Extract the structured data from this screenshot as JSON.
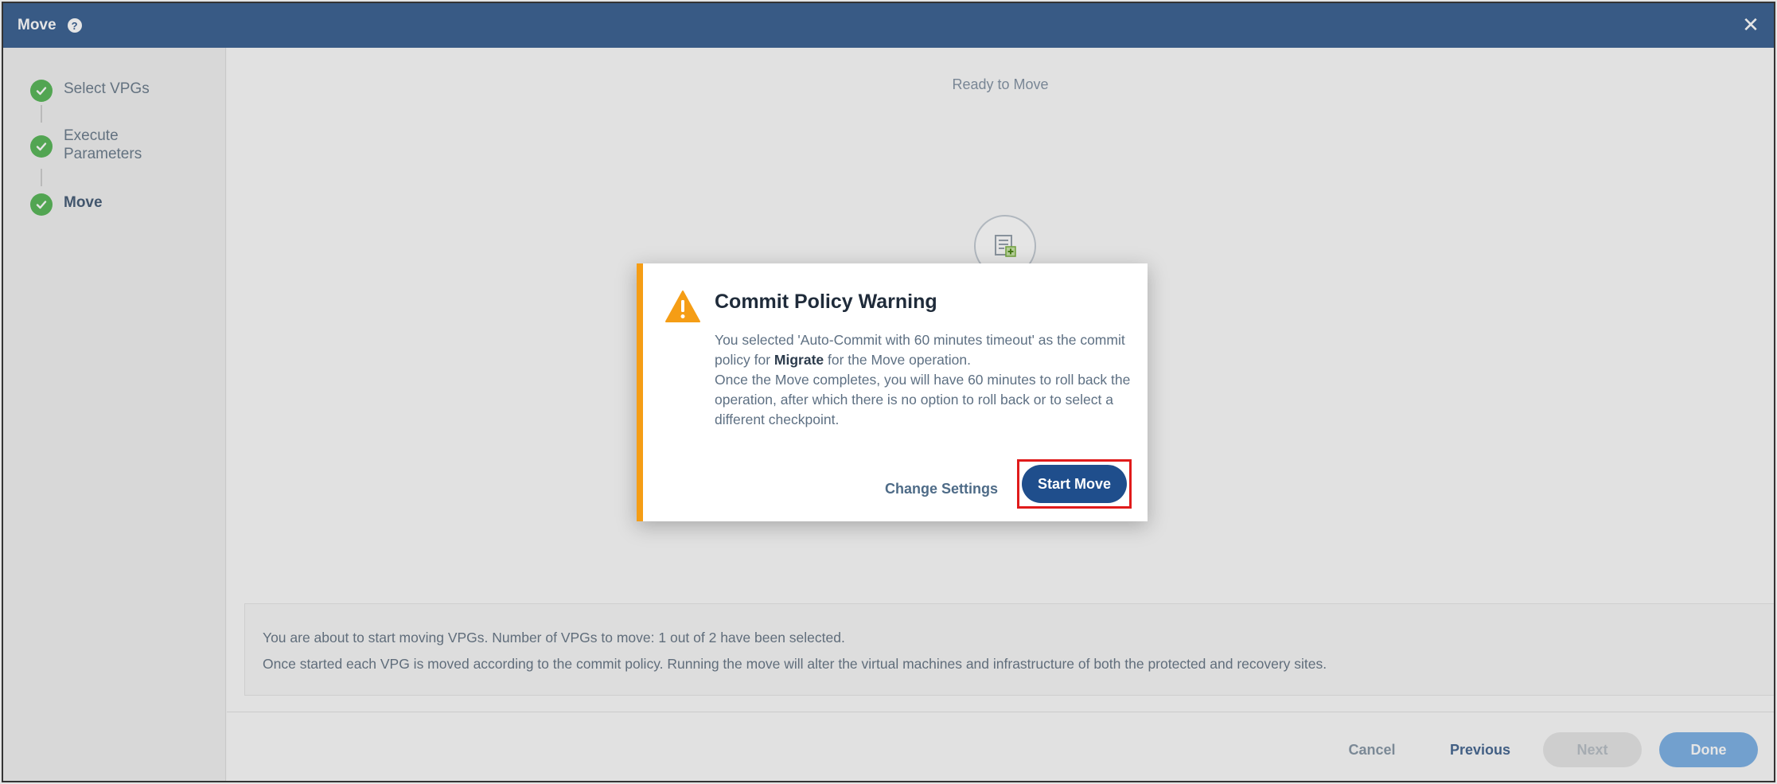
{
  "window": {
    "title": "Move",
    "help_glyph": "?",
    "close_glyph": "✕"
  },
  "steps": [
    {
      "label": "Select VPGs",
      "state": "complete"
    },
    {
      "label": "Execute Parameters",
      "state": "complete"
    },
    {
      "label": "Move",
      "state": "complete"
    }
  ],
  "main": {
    "heading": "Ready to Move",
    "info_line1": "You are about to start moving VPGs. Number of VPGs to move: 1 out of 2 have been selected.",
    "info_line2": "Once started each VPG is moved according to the commit policy. Running the move will alter the virtual machines and infrastructure of both the protected and recovery sites."
  },
  "footer": {
    "cancel": "Cancel",
    "previous": "Previous",
    "next": "Next",
    "done": "Done"
  },
  "dialog": {
    "title": "Commit Policy Warning",
    "body_part1": "You selected 'Auto-Commit with 60 minutes timeout' as the commit policy for ",
    "body_bold": "Migrate",
    "body_part2": " for the Move operation.",
    "body_line2": "Once the Move completes, you will have 60 minutes to roll back the operation, after which there is no option to roll back or to select a different checkpoint.",
    "change_settings": "Change Settings",
    "start_move": "Start Move"
  },
  "colors": {
    "titlebar": "#3f6595",
    "accent_warning": "#f59d15",
    "primary_button": "#1f4e8c",
    "step_complete": "#5cb85c",
    "highlight": "#e01b1b"
  },
  "icons": {
    "help": "help-circle-icon",
    "close": "close-icon",
    "step": "check-circle-icon",
    "warning": "warning-triangle-icon",
    "move": "vpg-move-icon"
  }
}
